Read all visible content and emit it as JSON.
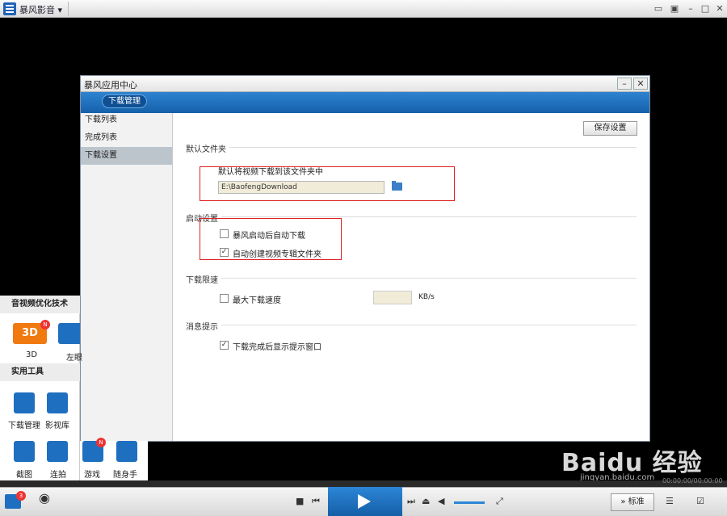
{
  "topbar": {
    "title": "暴风影音",
    "title_caret": "▾"
  },
  "dialog": {
    "title": "暴风应用中心",
    "minimize": "–",
    "close": "✕",
    "tab": "下载管理",
    "sidebar": [
      {
        "label": "下载列表"
      },
      {
        "label": "完成列表"
      },
      {
        "label": "下载设置"
      }
    ],
    "save_button": "保存设置",
    "sections": {
      "folder": {
        "title": "默认文件夹",
        "desc": "默认将视频下载到该文件夹中",
        "path": "E:\\BaofengDownload"
      },
      "startup": {
        "title": "启动设置",
        "option1": "暴风启动后自动下载",
        "option2": "自动创建视频专辑文件夹"
      },
      "speed": {
        "title": "下载限速",
        "label": "最大下载速度",
        "unit": "KB/s"
      },
      "notify": {
        "title": "消息提示",
        "option": "下载完成后显示提示窗口"
      }
    }
  },
  "left_panel": {
    "section1": "音视频优化技术",
    "items1": [
      {
        "label": "3D",
        "icon_text": "3D"
      },
      {
        "label": "左眼"
      }
    ],
    "section2": "实用工具",
    "items2": [
      {
        "label": "下载管理"
      },
      {
        "label": "影视库"
      }
    ],
    "items3": [
      {
        "label": "截图"
      },
      {
        "label": "连拍"
      },
      {
        "label": "游戏"
      },
      {
        "label": "随身手"
      }
    ],
    "badge_new": "N",
    "badge_count": "3"
  },
  "player": {
    "mode": "标准",
    "time": "00:00:00/00:00:00"
  },
  "watermark": {
    "brand": "Bai",
    "brand2": "du 经验",
    "site": "jingyan.baidu.com"
  },
  "colors": {
    "accent": "#1f6fc0",
    "highlight_box": "#e02020"
  }
}
